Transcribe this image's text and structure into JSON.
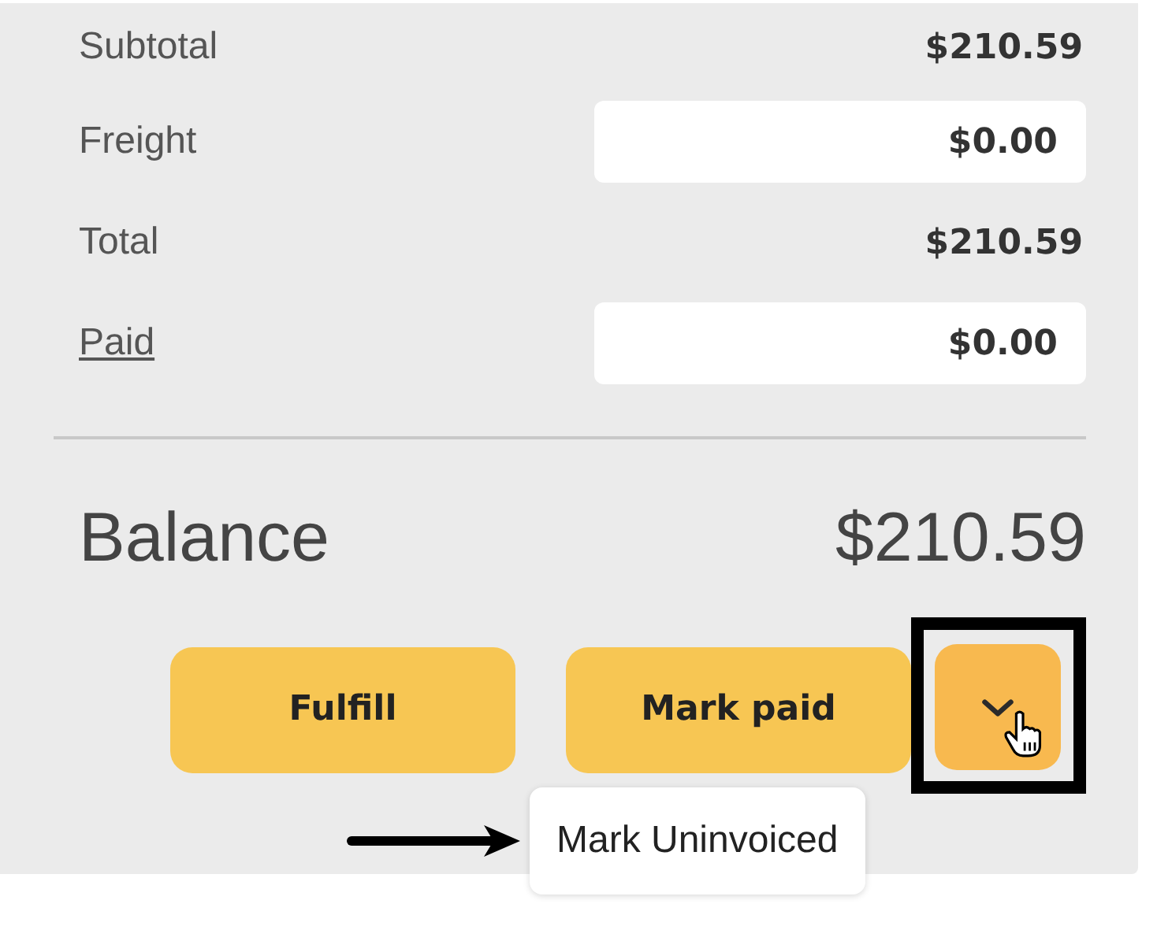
{
  "summary": [
    {
      "label": "Subtotal",
      "link": false,
      "kind": "static",
      "value": "$210.59"
    },
    {
      "label": "Freight",
      "link": false,
      "kind": "input",
      "value": "$0.00"
    },
    {
      "label": "Total",
      "link": false,
      "kind": "static",
      "value": "$210.59"
    },
    {
      "label": "Paid",
      "link": true,
      "kind": "input",
      "value": "$0.00"
    }
  ],
  "balance": {
    "label": "Balance",
    "value": "$210.59"
  },
  "buttons": [
    {
      "label": "Fulfill",
      "kind": "primary"
    },
    {
      "label": "Mark paid",
      "kind": "primary"
    },
    {
      "kind": "dropdown",
      "highlighted": true
    }
  ],
  "menu": {
    "items": [
      "Mark Uninvoiced"
    ]
  }
}
